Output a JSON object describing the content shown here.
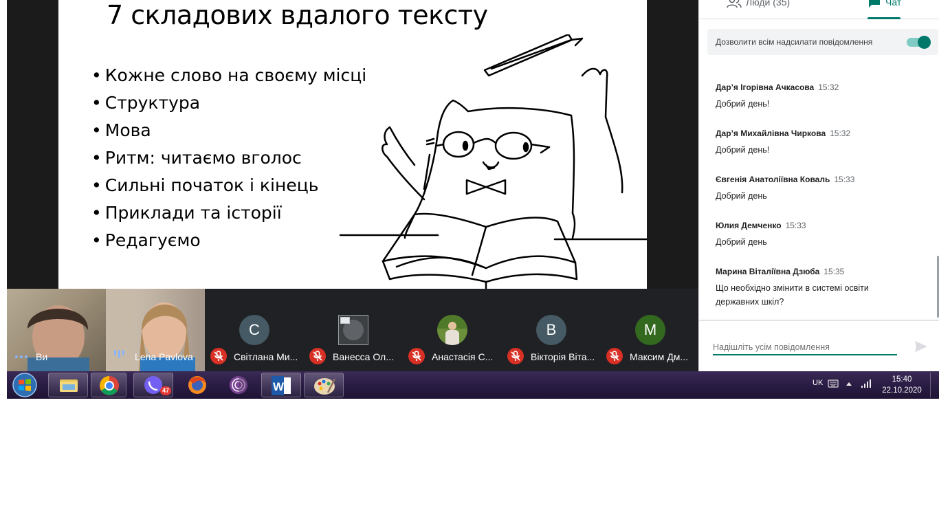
{
  "slide": {
    "title": "7 складових вдалого тексту",
    "bullets": [
      "Кожне слово на своєму місці",
      "Структура",
      "Мова",
      "Ритм: читаємо вголос",
      "Сильні початок і кінець",
      "Приклади та історії",
      "Редагуємо"
    ]
  },
  "participants": [
    {
      "name": "Ви",
      "type": "video",
      "muted": false
    },
    {
      "name": "Lena Pavlova",
      "type": "video",
      "muted": false
    },
    {
      "name": "Світлана Ми...",
      "type": "avatar",
      "initial": "С",
      "color": "#455a64",
      "muted": true
    },
    {
      "name": "Ванесса Ол...",
      "type": "image",
      "muted": true
    },
    {
      "name": "Анастасія С...",
      "type": "photo",
      "muted": true
    },
    {
      "name": "Вікторія Віта...",
      "type": "avatar",
      "initial": "В",
      "color": "#455a64",
      "muted": true
    },
    {
      "name": "Максим Дм...",
      "type": "avatar",
      "initial": "М",
      "color": "#33691e",
      "muted": true
    }
  ],
  "panel": {
    "tab_people": "Люди (35)",
    "tab_chat": "Чат",
    "allow_label": "Дозволити всім надсилати повідомлення",
    "allow_enabled": true,
    "composer_placeholder": "Надішліть усім повідомлення",
    "messages": [
      {
        "author": "Дар’я Ігорівна Ачкасова",
        "time": "15:32",
        "text": "Добрий день!"
      },
      {
        "author": "Дар’я Михайлівна Чиркова",
        "time": "15:32",
        "text": "Добрий день!"
      },
      {
        "author": "Євгенія Анатоліївна Коваль",
        "time": "15:33",
        "text": "Добрий день"
      },
      {
        "author": "Юлия Демченко",
        "time": "15:33",
        "text": "Добрий день"
      },
      {
        "author": "Марина Віталіївна Дзюба",
        "time": "15:35",
        "text": "Що необхідно змінити в системі освіти державних шкіл?"
      }
    ]
  },
  "taskbar": {
    "apps": [
      "start-orb",
      "file-explorer",
      "chrome",
      "viber",
      "firefox",
      "tor-browser",
      "word",
      "paint"
    ],
    "viber_badge": "47",
    "language": "UK",
    "time": "15:40",
    "date": "22.10.2020"
  }
}
